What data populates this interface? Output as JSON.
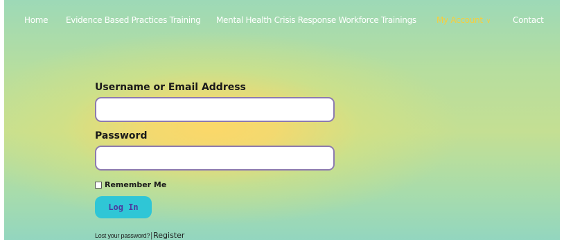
{
  "nav": {
    "items": [
      {
        "label": "Home"
      },
      {
        "label": "Evidence Based Practices Training"
      },
      {
        "label": "Mental Health Crisis Response Workforce Trainings"
      },
      {
        "label": "My Account",
        "active": true
      },
      {
        "label": "Contact"
      }
    ],
    "active_color": "#f7ce3c",
    "text_color": "#ffffff"
  },
  "form": {
    "username_label": "Username or Email Address",
    "username_value": "",
    "password_label": "Password",
    "password_value": "",
    "remember_label": "Remember Me",
    "remember_checked": false,
    "login_button": "Log In",
    "lost_password_link": "Lost your password?",
    "separator": "|",
    "register_link": "Register"
  },
  "colors": {
    "button_bg": "#2fc6d6",
    "button_text": "#4b3aa0",
    "field_border": "#8c7ab0"
  },
  "icons": {
    "dropdown": "chevron-down-icon"
  }
}
